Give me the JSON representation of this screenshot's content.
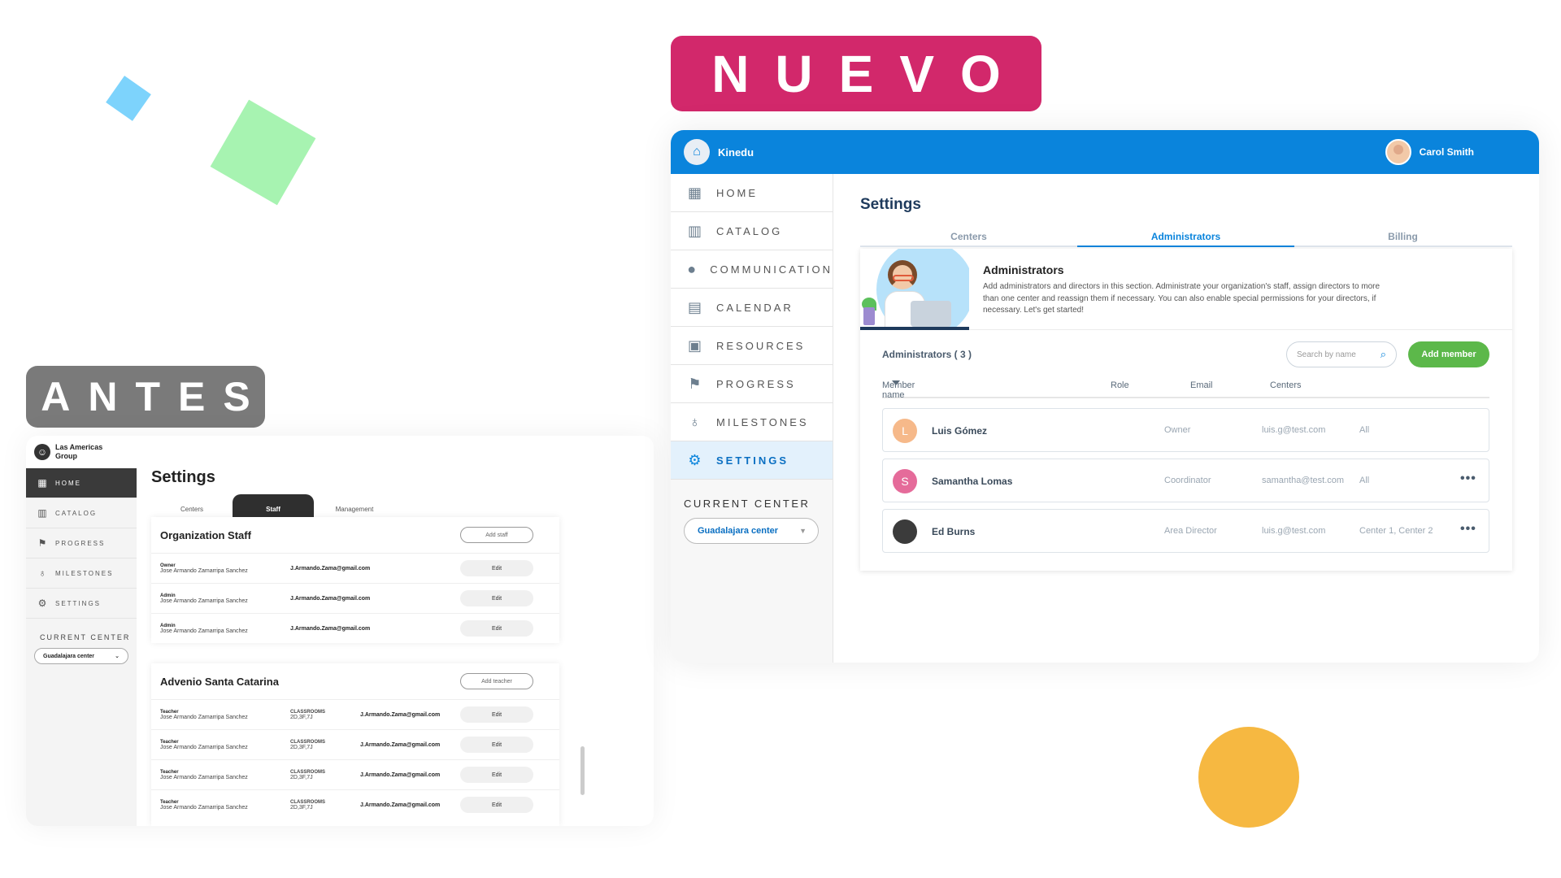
{
  "labels": {
    "nuevo": "NUEVO",
    "antes": "ANTES"
  },
  "colors": {
    "nuevo_bg": "#d2286b",
    "antes_bg": "#7a7a7a",
    "new_topbar": "#0a84dc",
    "add_member_green": "#5cb84a",
    "deco_orange": "#f6b841",
    "deco_green": "#a7f3b1",
    "deco_blue": "#7dd3fc"
  },
  "old_ui": {
    "brand": "Las Americas Group",
    "nav": [
      {
        "label": "HOME",
        "icon": "blocks-icon"
      },
      {
        "label": "CATALOG",
        "icon": "book-icon"
      },
      {
        "label": "PROGRESS",
        "icon": "flag-icon"
      },
      {
        "label": "MILESTONES",
        "icon": "medal-icon"
      },
      {
        "label": "SETTINGS",
        "icon": "gear-icon"
      }
    ],
    "current_center_label": "CURRENT CENTER",
    "current_center_value": "Guadalajara center",
    "title": "Settings",
    "tabs": [
      "Centers",
      "Staff",
      "Management"
    ],
    "org_card": {
      "title": "Organization Staff",
      "add_label": "Add staff",
      "rows": [
        {
          "role": "Owner",
          "name": "Jose Armando Zamarripa Sanchez",
          "email": "J.Armando.Zama@gmail.com",
          "action": "Edit"
        },
        {
          "role": "Admin",
          "name": "Jose Armando Zamarripa Sanchez",
          "email": "J.Armando.Zama@gmail.com",
          "action": "Edit"
        },
        {
          "role": "Admin",
          "name": "Jose Armando Zamarripa Sanchez",
          "email": "J.Armando.Zama@gmail.com",
          "action": "Edit"
        }
      ]
    },
    "center_card": {
      "title": "Advenio Santa Catarina",
      "add_label": "Add teacher",
      "rows": [
        {
          "role": "Teacher",
          "name": "Jose Armando Zamarripa Sanchez",
          "classrooms_label": "CLASSROOMS",
          "classrooms": "2D,3F,7J",
          "email": "J.Armando.Zama@gmail.com",
          "action": "Edit"
        },
        {
          "role": "Teacher",
          "name": "Jose Armando Zamarripa Sanchez",
          "classrooms_label": "CLASSROOMS",
          "classrooms": "2D,3F,7J",
          "email": "J.Armando.Zama@gmail.com",
          "action": "Edit"
        },
        {
          "role": "Teacher",
          "name": "Jose Armando Zamarripa Sanchez",
          "classrooms_label": "CLASSROOMS",
          "classrooms": "2D,3F,7J",
          "email": "J.Armando.Zama@gmail.com",
          "action": "Edit"
        },
        {
          "role": "Teacher",
          "name": "Jose Armando Zamarripa Sanchez",
          "classrooms_label": "CLASSROOMS",
          "classrooms": "2D,3F,7J",
          "email": "J.Armando.Zama@gmail.com",
          "action": "Edit"
        }
      ]
    }
  },
  "new_ui": {
    "brand": "Kinedu",
    "user": "Carol Smith",
    "nav": [
      {
        "label": "HOME",
        "icon": "blocks-icon"
      },
      {
        "label": "CATALOG",
        "icon": "book-icon"
      },
      {
        "label": "COMMUNICATION",
        "icon": "chat-bubble-icon"
      },
      {
        "label": "CALENDAR",
        "icon": "calendar-icon"
      },
      {
        "label": "RESOURCES",
        "icon": "resources-icon"
      },
      {
        "label": "PROGRESS",
        "icon": "flag-icon"
      },
      {
        "label": "MILESTONES",
        "icon": "medal-icon"
      },
      {
        "label": "SETTINGS",
        "icon": "gear-icon"
      }
    ],
    "current_center_label": "CURRENT CENTER",
    "current_center_value": "Guadalajara center",
    "title": "Settings",
    "tabs": [
      "Centers",
      "Administrators",
      "Billing"
    ],
    "banner": {
      "title": "Administrators",
      "description": "Add administrators and directors in this section. Administrate your organization's staff, assign directors to more than one center and reassign them if necessary. You can also enable special permissions for your directors, if necessary. Let's get started!"
    },
    "list_count": "Administrators ( 3 )",
    "search_placeholder": "Search by name",
    "add_member": "Add member",
    "columns": {
      "name": "Member name",
      "role": "Role",
      "email": "Email",
      "centers": "Centers"
    },
    "members": [
      {
        "initial": "L",
        "avatar_color": "#f6b98a",
        "name": "Luis Gómez",
        "role": "Owner",
        "email": "luis.g@test.com",
        "centers": "All",
        "more": ""
      },
      {
        "initial": "S",
        "avatar_color": "#e56b9a",
        "name": "Samantha Lomas",
        "role": "Coordinator",
        "email": "samantha@test.com",
        "centers": "All",
        "more": "•••"
      },
      {
        "initial": "",
        "avatar_color": "#3b3b3b",
        "name": "Ed Burns",
        "role": "Area Director",
        "email": "luis.g@test.com",
        "centers": "Center 1, Center 2",
        "more": "•••"
      }
    ]
  }
}
